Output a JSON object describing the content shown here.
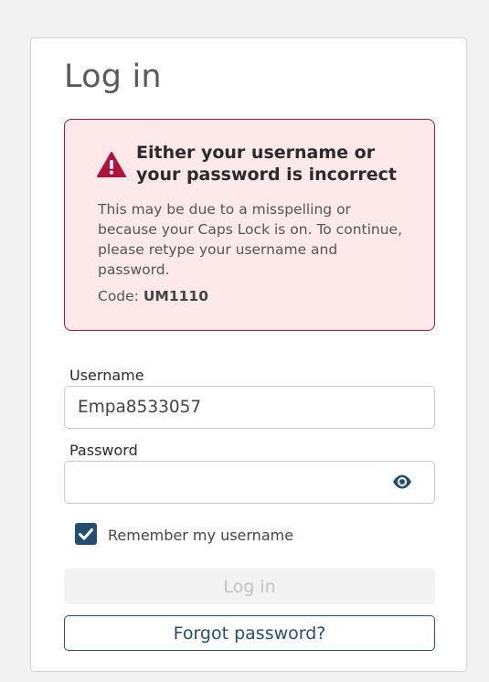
{
  "page": {
    "title": "Log in"
  },
  "alert": {
    "icon": "warning-triangle-icon",
    "heading": "Either your username or your password is incorrect",
    "body": "This may be due to a misspelling or because your Caps Lock is on. To continue, please retype your username and password.",
    "code_label": "Code:",
    "code_value": "UM1110",
    "color": "#b0123b",
    "background": "#fde8ea"
  },
  "form": {
    "username_label": "Username",
    "username_value": "Empa8533057",
    "password_label": "Password",
    "password_value": "",
    "password_toggle_icon": "eye-icon",
    "remember_label": "Remember my username",
    "remember_checked": true,
    "login_label": "Log in",
    "login_disabled": true,
    "forgot_label": "Forgot password?"
  },
  "colors": {
    "accent": "#264e73",
    "error": "#b0123b"
  }
}
